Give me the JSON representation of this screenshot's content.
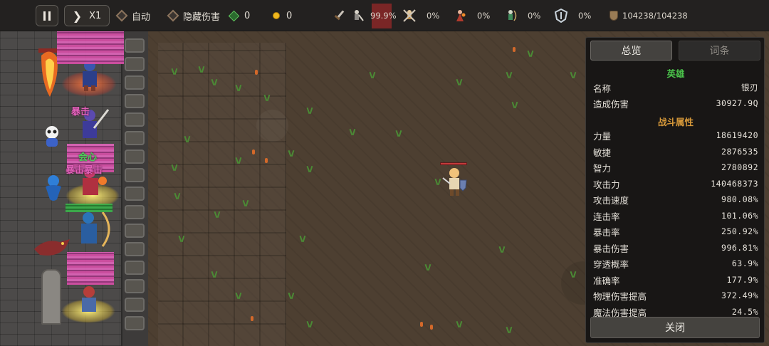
{
  "topbar": {
    "speed_label": "X1",
    "auto_label": "自动",
    "hide_damage_label": "隐藏伤害",
    "gem_count": "0",
    "gold_count": "0",
    "heroes": [
      {
        "icon": "swordsman-hero-icon",
        "percent": "99.9%",
        "highlight_color": "#7a2626"
      },
      {
        "icon": "dual-blade-hero-icon",
        "percent": "0%"
      },
      {
        "icon": "fire-mage-hero-icon",
        "percent": "0%"
      },
      {
        "icon": "archer-hero-icon",
        "percent": "0%"
      },
      {
        "icon": "shield-spirit-hero-icon",
        "percent": "0%"
      }
    ],
    "wall_hp": "104238/104238"
  },
  "panel": {
    "tabs": [
      "总览",
      "词条"
    ],
    "hero_section_title": "英雄",
    "hero_rows": [
      {
        "label": "名称",
        "value": "银刃"
      },
      {
        "label": "造成伤害",
        "value": "30927.9Q"
      }
    ],
    "attr_section_title": "战斗属性",
    "attr_rows": [
      {
        "label": "力量",
        "value": "18619420"
      },
      {
        "label": "敏捷",
        "value": "2876535"
      },
      {
        "label": "智力",
        "value": "2780892"
      },
      {
        "label": "攻击力",
        "value": "140468373"
      },
      {
        "label": "攻击速度",
        "value": "980.08%"
      },
      {
        "label": "连击率",
        "value": "101.06%"
      },
      {
        "label": "暴击率",
        "value": "250.92%"
      },
      {
        "label": "暴击伤害",
        "value": "996.81%"
      },
      {
        "label": "穿透概率",
        "value": "63.9%"
      },
      {
        "label": "准确率",
        "value": "177.9%"
      },
      {
        "label": "物理伤害提高",
        "value": "372.49%"
      },
      {
        "label": "魔法伤害提高",
        "value": "24.5%"
      }
    ],
    "close_label": "关闭"
  },
  "colors": {
    "hero_section": "#4ac24a",
    "attr_section": "#d89a3a",
    "glitch_pink": "#d84fa8"
  },
  "floating_texts": [
    "暴击",
    "会心",
    "暴击暴击"
  ]
}
